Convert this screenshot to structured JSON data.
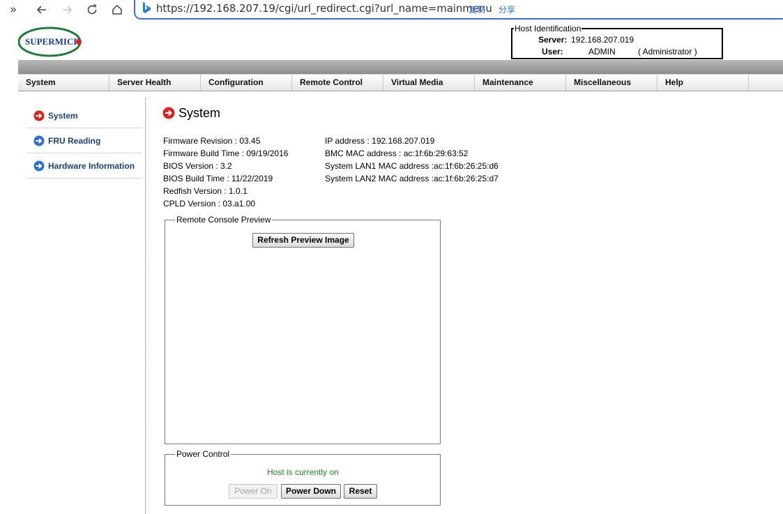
{
  "browser": {
    "url": "https://192.168.207.19/cgi/url_redirect.cgi?url_name=mainmenu",
    "copy_label": "复制",
    "share_label": "分享"
  },
  "header": {
    "logo_text": "SUPERMICRO",
    "host_identification": {
      "legend": "Host Identification",
      "server_label": "Server:",
      "server_value": "192.168.207.019",
      "user_label": "User:",
      "user_value": "ADMIN",
      "user_role": "( Administrator )"
    }
  },
  "menu": [
    "System",
    "Server Health",
    "Configuration",
    "Remote Control",
    "Virtual Media",
    "Maintenance",
    "Miscellaneous",
    "Help"
  ],
  "sidebar": {
    "items": [
      {
        "label": "System",
        "icon": "red-arrow-icon"
      },
      {
        "label": "FRU Reading",
        "icon": "blue-arrow-icon"
      },
      {
        "label": "Hardware Information",
        "icon": "blue-arrow-icon"
      }
    ]
  },
  "main": {
    "title": "System",
    "left_info": [
      "Firmware Revision :  03.45",
      "Firmware Build Time :  09/19/2016",
      "BIOS Version : 3.2",
      "BIOS Build Time : 11/22/2019",
      "Redfish Version : 1.0.1",
      "CPLD Version : 03.a1.00"
    ],
    "right_info": [
      "IP address :  192.168.207.019",
      "BMC MAC address :  ac:1f:6b:29:63:52",
      "System LAN1 MAC address :ac:1f:6b:26:25:d6",
      "System LAN2 MAC address :ac:1f:6b:26:25:d7"
    ],
    "remote_console": {
      "legend": "Remote Console Preview",
      "refresh_button": "Refresh Preview Image"
    },
    "power_control": {
      "legend": "Power Control",
      "status": "Host is currently on",
      "power_on_button": "Power On",
      "power_down_button": "Power Down",
      "reset_button": "Reset"
    }
  },
  "colors": {
    "address_border": "#3b6fd6",
    "status_green": "#1d8a1d",
    "sidebar_link": "#1d3f7a",
    "active_arrow": "#e02020",
    "nav_arrow": "#2f6fd8"
  }
}
